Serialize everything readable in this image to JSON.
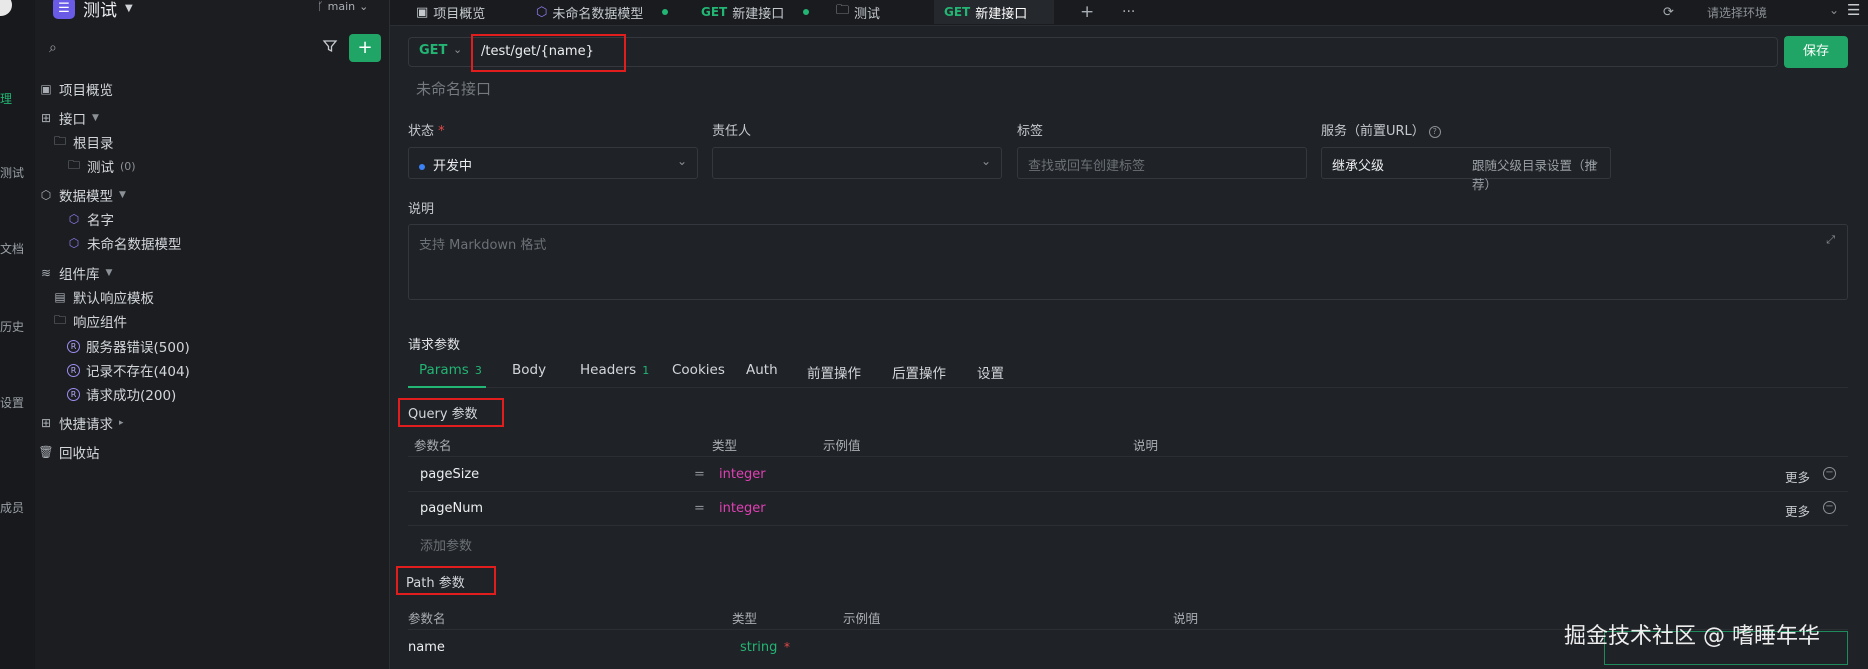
{
  "rail": {
    "items": [
      "理",
      "测试",
      "文档",
      "历史",
      "设置",
      "成员"
    ]
  },
  "sidebar": {
    "project_name": "测试",
    "branch": "main",
    "tree": {
      "overview": "项目概览",
      "interfaces": "接口",
      "root_dir": "根目录",
      "folder_test": "测试",
      "folder_test_count": "(0)",
      "data_models": "数据模型",
      "model_name": "名字",
      "model_unnamed": "未命名数据模型",
      "components": "组件库",
      "default_response": "默认响应模板",
      "response_components": "响应组件",
      "resp_500": "服务器错误(500)",
      "resp_404": "记录不存在(404)",
      "resp_200": "请求成功(200)",
      "quick_request": "快捷请求",
      "recycle_bin": "回收站"
    }
  },
  "tabs": {
    "t1": "项目概览",
    "t2": "未命名数据模型",
    "t3_method": "GET",
    "t3": "新建接口",
    "t4": "测试",
    "t5_method": "GET",
    "t5": "新建接口",
    "add": "+",
    "more": "···",
    "env_placeholder": "请选择环境"
  },
  "request": {
    "method": "GET",
    "url": "/test/get/{name}",
    "save": "保存",
    "api_name_placeholder": "未命名接口",
    "status_label": "状态",
    "status_value": "开发中",
    "owner_label": "责任人",
    "tags_label": "标签",
    "tags_placeholder": "查找或回车创建标签",
    "service_label": "服务（前置URL）",
    "service_value": "继承父级",
    "service_hint": "跟随父级目录设置（推荐）",
    "desc_label": "说明",
    "desc_placeholder": "支持 Markdown 格式",
    "params_title": "请求参数"
  },
  "param_tabs": {
    "params": "Params",
    "params_count": "3",
    "body": "Body",
    "headers": "Headers",
    "headers_count": "1",
    "cookies": "Cookies",
    "auth": "Auth",
    "pre": "前置操作",
    "post": "后置操作",
    "settings": "设置"
  },
  "query": {
    "title": "Query 参数",
    "col_name": "参数名",
    "col_type": "类型",
    "col_example": "示例值",
    "col_desc": "说明",
    "rows": [
      {
        "name": "pageSize",
        "type": "integer",
        "more": "更多"
      },
      {
        "name": "pageNum",
        "type": "integer",
        "more": "更多"
      }
    ],
    "add": "添加参数"
  },
  "path": {
    "title": "Path 参数",
    "col_name": "参数名",
    "col_type": "类型",
    "col_example": "示例值",
    "col_desc": "说明",
    "rows": [
      {
        "name": "name",
        "type": "string",
        "required": "*"
      }
    ]
  },
  "watermark": "掘金技术社区 @ 嗜睡年华",
  "colors": {
    "accent": "#22b573",
    "highlight": "#e11d1d",
    "type_integer": "#e040b5"
  }
}
